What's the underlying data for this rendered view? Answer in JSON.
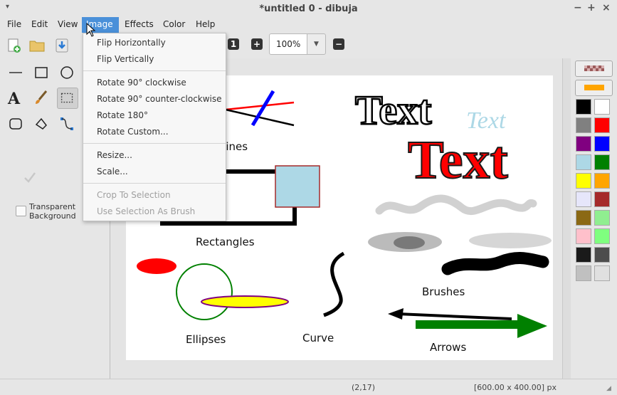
{
  "window": {
    "title": "*untitled 0 - dibuja",
    "menu_arrow": "▾",
    "minimize": "−",
    "maximize": "+",
    "close": "×"
  },
  "menubar": [
    {
      "label": "File"
    },
    {
      "label": "Edit"
    },
    {
      "label": "View"
    },
    {
      "label": "Image",
      "active": true
    },
    {
      "label": "Effects"
    },
    {
      "label": "Color"
    },
    {
      "label": "Help"
    }
  ],
  "toolbar": {
    "icons": [
      "new-image-icon",
      "open-folder-icon",
      "save-icon"
    ],
    "zoom_minus": "−",
    "zoom_plus": "+",
    "zoom_one": "1",
    "zoom_value": "100%",
    "zoom_dropdown": "▼"
  },
  "image_menu": {
    "groups": [
      [
        {
          "label": "Flip Horizontally"
        },
        {
          "label": "Flip Vertically"
        }
      ],
      [
        {
          "label": "Rotate 90° clockwise"
        },
        {
          "label": "Rotate 90° counter-clockwise"
        },
        {
          "label": "Rotate 180°"
        },
        {
          "label": "Rotate Custom..."
        }
      ],
      [
        {
          "label": "Resize..."
        },
        {
          "label": "Scale..."
        }
      ],
      [
        {
          "label": "Crop To Selection",
          "disabled": true
        },
        {
          "label": "Use Selection As Brush",
          "disabled": true
        }
      ]
    ]
  },
  "tools": {
    "items": [
      "line-tool-icon",
      "rectangle-tool-icon",
      "ellipse-tool-icon",
      "text-tool-icon",
      "paintbrush-tool-icon",
      "rectangle-select-tool-icon",
      "rounded-rectangle-tool-icon",
      "free-select-tool-icon",
      "curve-tool-icon"
    ],
    "selected": "rectangle-select-tool-icon",
    "transparent_background_label": "Transparent Background"
  },
  "canvas": {
    "labels": {
      "lines": "Lines",
      "rectangles": "Rectangles",
      "ellipses": "Ellipses",
      "curve": "Curve",
      "brushes": "Brushes",
      "arrows": "Arrows"
    },
    "texts": {
      "outline": "Text",
      "italic": "Text",
      "big": "Text"
    },
    "colors": {
      "red": "#ff0000",
      "blue": "#0000ff",
      "lightblue": "#add8e6",
      "yellow": "#ffff00",
      "green": "#008000",
      "purple": "#800080"
    }
  },
  "palette": {
    "swatches": [
      "#000000",
      "#ffffff",
      "#808080",
      "#ff0000",
      "#800080",
      "#0000ff",
      "#add8e6",
      "#008000",
      "#ffff00",
      "#ffa500",
      "#e6e6fa",
      "#a52a2a",
      "#8b6914",
      "#90ee90",
      "#ffc0cb",
      "#7fff7f",
      "#1a1a1a",
      "#4d4d4d",
      "#c0c0c0",
      "#e0e0e0"
    ],
    "primary_color": "#ffa500"
  },
  "status": {
    "position": "(2,17)",
    "size": "[600.00 x 400.00] px"
  }
}
